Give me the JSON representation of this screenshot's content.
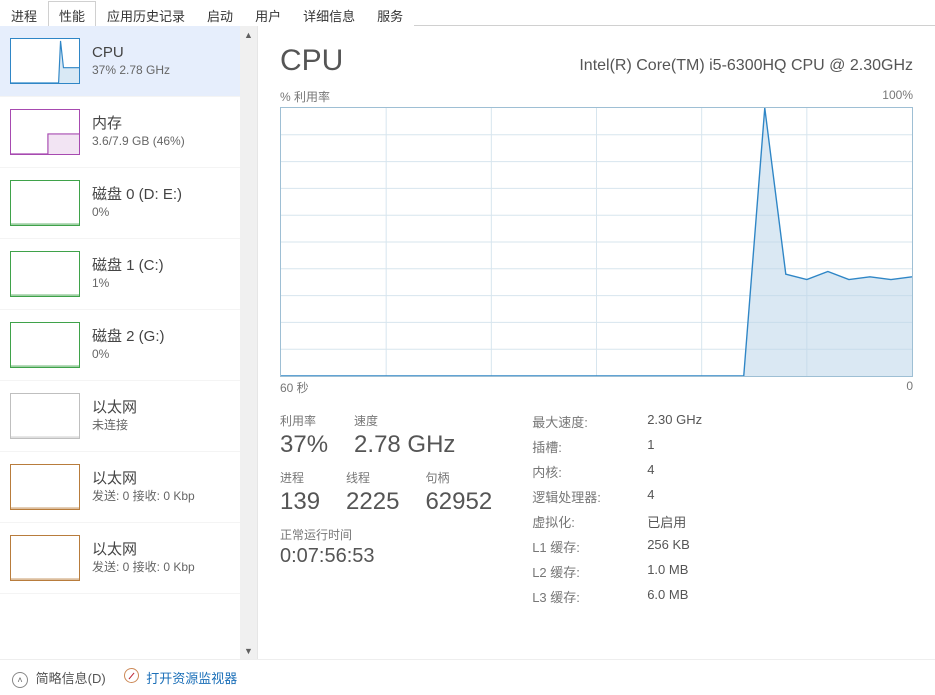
{
  "tabs": [
    {
      "label": "进程"
    },
    {
      "label": "性能"
    },
    {
      "label": "应用历史记录"
    },
    {
      "label": "启动"
    },
    {
      "label": "用户"
    },
    {
      "label": "详细信息"
    },
    {
      "label": "服务"
    }
  ],
  "active_tab_index": 1,
  "sidebar": [
    {
      "name": "CPU",
      "sub": "37% 2.78 GHz",
      "color": "#2f86c6",
      "thumb": "cpu",
      "selected": true
    },
    {
      "name": "内存",
      "sub": "3.6/7.9 GB (46%)",
      "color": "#a74ab0",
      "thumb": "mem",
      "selected": false
    },
    {
      "name": "磁盘 0 (D: E:)",
      "sub": "0%",
      "color": "#3fa24a",
      "thumb": "disk",
      "selected": false
    },
    {
      "name": "磁盘 1 (C:)",
      "sub": "1%",
      "color": "#3fa24a",
      "thumb": "disk",
      "selected": false
    },
    {
      "name": "磁盘 2 (G:)",
      "sub": "0%",
      "color": "#3fa24a",
      "thumb": "disk",
      "selected": false
    },
    {
      "name": "以太网",
      "sub": "未连接",
      "color": "#bfbfbf",
      "thumb": "eth",
      "selected": false
    },
    {
      "name": "以太网",
      "sub": "发送: 0 接收: 0 Kbp",
      "color": "#b87c3c",
      "thumb": "eth",
      "selected": false
    },
    {
      "name": "以太网",
      "sub": "发送: 0 接收: 0 Kbp",
      "color": "#b87c3c",
      "thumb": "eth",
      "selected": false
    }
  ],
  "detail": {
    "title": "CPU",
    "subtitle": "Intel(R) Core(TM) i5-6300HQ CPU @ 2.30GHz",
    "chart_y_label": "% 利用率",
    "chart_y_max": "100%",
    "chart_x_left": "60 秒",
    "chart_x_right": "0",
    "big": [
      {
        "label": "利用率",
        "value": "37%"
      },
      {
        "label": "速度",
        "value": "2.78 GHz"
      }
    ],
    "big2": [
      {
        "label": "进程",
        "value": "139"
      },
      {
        "label": "线程",
        "value": "2225"
      },
      {
        "label": "句柄",
        "value": "62952"
      }
    ],
    "uptime_label": "正常运行时间",
    "uptime_value": "0:07:56:53",
    "info": [
      {
        "k": "最大速度:",
        "v": "2.30 GHz"
      },
      {
        "k": "插槽:",
        "v": "1"
      },
      {
        "k": "内核:",
        "v": "4"
      },
      {
        "k": "逻辑处理器:",
        "v": "4"
      },
      {
        "k": "虚拟化:",
        "v": "已启用"
      },
      {
        "k": "L1 缓存:",
        "v": "256 KB"
      },
      {
        "k": "L2 缓存:",
        "v": "1.0 MB"
      },
      {
        "k": "L3 缓存:",
        "v": "6.0 MB"
      }
    ]
  },
  "footer": {
    "fewer_details": "简略信息(D)",
    "resource_monitor": "打开资源监视器"
  },
  "chart_data": {
    "type": "area",
    "title": "CPU % 利用率",
    "xlabel": "秒",
    "ylabel": "% 利用率",
    "xlim": [
      60,
      0
    ],
    "ylim": [
      0,
      100
    ],
    "series": [
      {
        "name": "CPU 利用率",
        "x": [
          60,
          58,
          56,
          54,
          52,
          50,
          48,
          46,
          44,
          42,
          40,
          38,
          36,
          34,
          32,
          30,
          28,
          26,
          24,
          22,
          20,
          18,
          16,
          14,
          12,
          10,
          8,
          6,
          4,
          2,
          0
        ],
        "y": [
          0,
          0,
          0,
          0,
          0,
          0,
          0,
          0,
          0,
          0,
          0,
          0,
          0,
          0,
          0,
          0,
          0,
          0,
          0,
          0,
          0,
          0,
          0,
          100,
          38,
          36,
          39,
          36,
          37,
          36,
          37
        ]
      }
    ]
  }
}
